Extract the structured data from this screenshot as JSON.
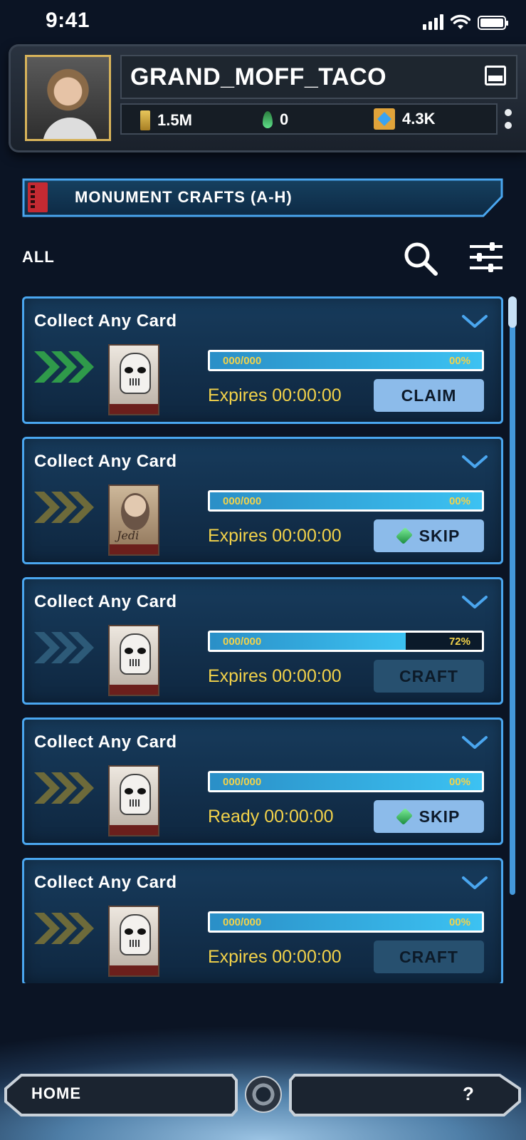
{
  "status_bar": {
    "time": "9:41"
  },
  "profile": {
    "username": "GRAND_MOFF_TACO",
    "credits": "1.5M",
    "crystals": "0",
    "tokens": "4.3K"
  },
  "category": {
    "title": "MONUMENT CRAFTS (A-H)"
  },
  "filter": {
    "label": "ALL"
  },
  "colors": {
    "accent": "#4aa6ef",
    "gold": "#f2d24a",
    "button": "#8cbbea",
    "button_disabled": "#27506f"
  },
  "crafts": [
    {
      "title": "Collect Any Card",
      "progress_text": "000/000",
      "percent_text": "00%",
      "progress": 1.0,
      "timer": "Expires 00:00:00",
      "action": "CLAIM",
      "action_state": "active",
      "action_icon": "",
      "arrow_color": "#2f9a4a",
      "card": "stormtrooper"
    },
    {
      "title": "Collect Any Card",
      "progress_text": "000/000",
      "percent_text": "00%",
      "progress": 1.0,
      "timer": "Expires 00:00:00",
      "action": "SKIP",
      "action_state": "active",
      "action_icon": "gem-icon",
      "arrow_color": "#6d6a3a",
      "card": "vintage-portrait"
    },
    {
      "title": "Collect Any Card",
      "progress_text": "000/000",
      "percent_text": "72%",
      "progress": 0.72,
      "timer": "Expires 00:00:00",
      "action": "CRAFT",
      "action_state": "disabled",
      "action_icon": "",
      "arrow_color": "#2d5a78",
      "card": "stormtrooper"
    },
    {
      "title": "Collect Any Card",
      "progress_text": "000/000",
      "percent_text": "00%",
      "progress": 1.0,
      "timer": "Ready 00:00:00",
      "action": "SKIP",
      "action_state": "active",
      "action_icon": "gem-icon",
      "arrow_color": "#6d6a3a",
      "card": "stormtrooper"
    },
    {
      "title": "Collect Any Card",
      "progress_text": "000/000",
      "percent_text": "00%",
      "progress": 1.0,
      "timer": "Expires 00:00:00",
      "action": "CRAFT",
      "action_state": "disabled",
      "action_icon": "",
      "arrow_color": "#6d6a3a",
      "card": "stormtrooper"
    }
  ],
  "nav": {
    "home_label": "HOME",
    "help_label": "?"
  }
}
